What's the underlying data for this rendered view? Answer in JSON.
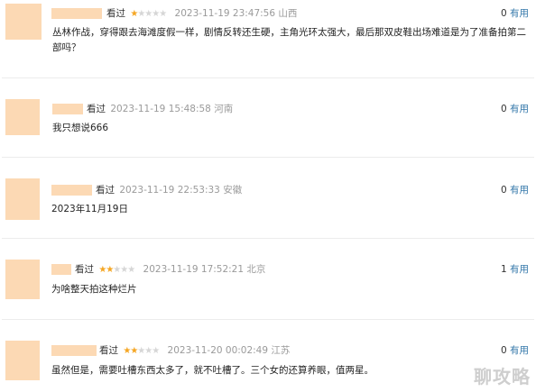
{
  "comments": [
    {
      "watched_label": "看过",
      "rating": 1,
      "timestamp": "2023-11-19 23:47:56",
      "location": "山西",
      "votes": "0",
      "useful_label": "有用",
      "text": "丛林作战，穿得跟去海滩度假一样，剧情反转还生硬，主角光环太强大，最后那双皮鞋出场难道是为了准备拍第二部吗？"
    },
    {
      "watched_label": "看过",
      "rating": 0,
      "timestamp": "2023-11-19 15:48:58",
      "location": "河南",
      "votes": "0",
      "useful_label": "有用",
      "text": "我只想说666"
    },
    {
      "watched_label": "看过",
      "rating": 0,
      "timestamp": "2023-11-19 22:53:33",
      "location": "安徽",
      "votes": "0",
      "useful_label": "有用",
      "text": "2023年11月19日"
    },
    {
      "watched_label": "看过",
      "rating": 2,
      "timestamp": "2023-11-19 17:52:21",
      "location": "北京",
      "votes": "1",
      "useful_label": "有用",
      "text": "为啥整天拍这种烂片"
    },
    {
      "watched_label": "看过",
      "rating": 2,
      "timestamp": "2023-11-20 00:02:49",
      "location": "江苏",
      "votes": "0",
      "useful_label": "有用",
      "text": "虽然但是，需要吐槽东西太多了，就不吐槽了。三个女的还算养眼，值两星。"
    }
  ],
  "watermark": "聊攻略",
  "colors": {
    "avatar_placeholder": "#fcd9b4",
    "star_on": "#f5a623",
    "star_off": "#d6d6d6",
    "useful_link": "#3377aa"
  }
}
